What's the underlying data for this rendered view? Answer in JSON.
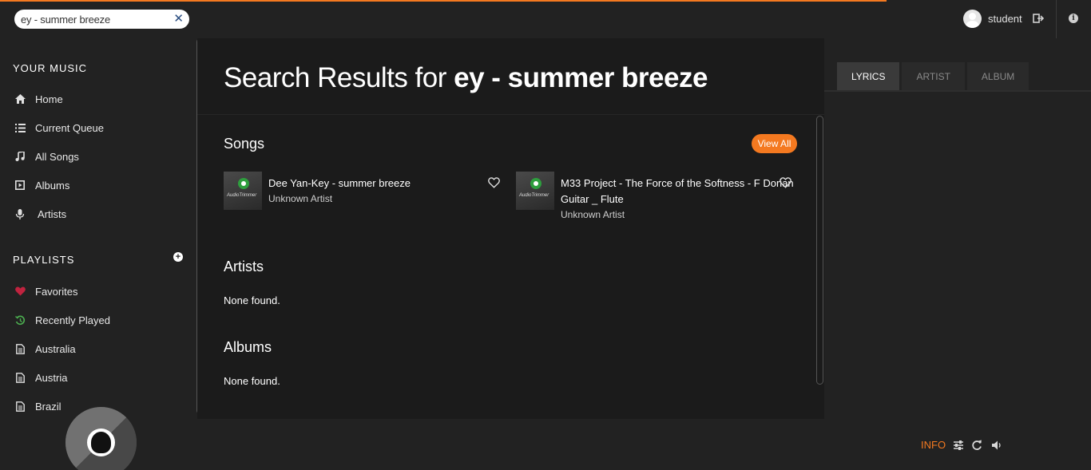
{
  "search": {
    "value": "ey - summer breeze",
    "clear_icon": "close-icon"
  },
  "header": {
    "username": "student",
    "logout_icon": "logout-icon",
    "info_icon": "info-icon"
  },
  "sidebar": {
    "your_music_heading": "YOUR MUSIC",
    "items": [
      {
        "label": "Home",
        "icon": "home-icon"
      },
      {
        "label": "Current Queue",
        "icon": "list-icon"
      },
      {
        "label": "All Songs",
        "icon": "music-note-icon"
      },
      {
        "label": "Albums",
        "icon": "album-icon"
      },
      {
        "label": "Artists",
        "icon": "microphone-icon"
      }
    ],
    "playlists_heading": "PLAYLISTS",
    "playlists": [
      {
        "label": "Favorites",
        "icon": "heart-icon",
        "color": "#c0233f"
      },
      {
        "label": "Recently Played",
        "icon": "history-icon",
        "color": "#4caf50"
      },
      {
        "label": "Australia",
        "icon": "file-icon"
      },
      {
        "label": "Austria",
        "icon": "file-icon"
      },
      {
        "label": "Brazil",
        "icon": "file-icon"
      }
    ]
  },
  "main": {
    "title_prefix": "Search Results for ",
    "title_query": "ey - summer breeze",
    "songs_heading": "Songs",
    "view_all_label": "View All",
    "songs": [
      {
        "title": "Dee Yan-Key - summer breeze",
        "artist": "Unknown Artist",
        "cover_text": "AudioTrimmer"
      },
      {
        "title_line1": "M33 Project - The Force of the Softness - F Dorian",
        "title_line2": "Guitar _ Flute",
        "artist": "Unknown Artist",
        "cover_text": "AudioTrimmer"
      }
    ],
    "artists_heading": "Artists",
    "artists_empty": "None found.",
    "albums_heading": "Albums",
    "albums_empty": "None found."
  },
  "right_panel": {
    "tabs": [
      {
        "label": "LYRICS",
        "active": true
      },
      {
        "label": "ARTIST",
        "active": false
      },
      {
        "label": "ALBUM",
        "active": false
      }
    ]
  },
  "footer": {
    "info_label": "INFO",
    "icons": [
      "equalizer-icon",
      "repeat-icon",
      "volume-icon"
    ]
  },
  "colors": {
    "accent": "#f47920",
    "background": "#222222",
    "main_background": "#1b1b1b"
  }
}
